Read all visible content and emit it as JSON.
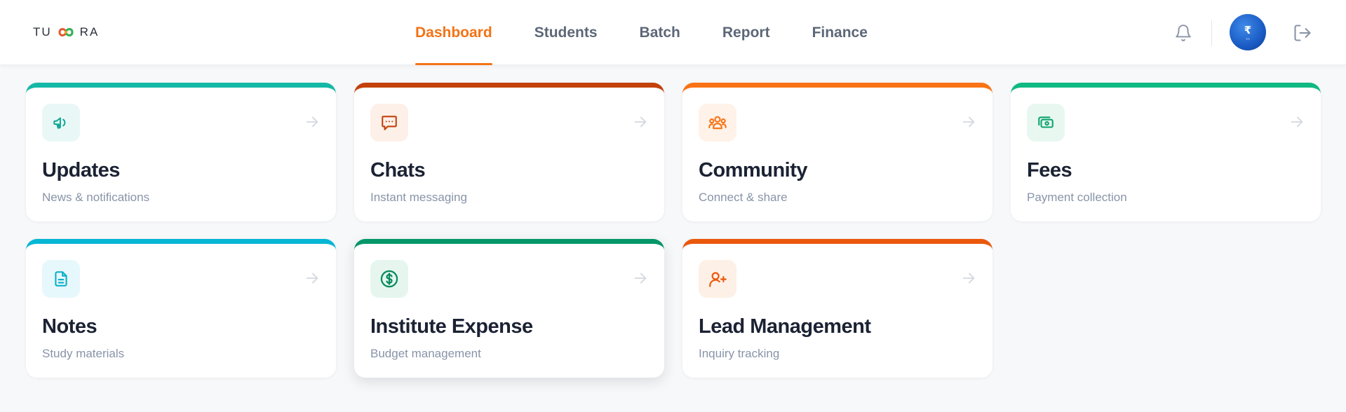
{
  "brand": {
    "logo_left": "TU",
    "logo_right": "RA"
  },
  "nav": {
    "tabs": [
      {
        "label": "Dashboard",
        "active": true
      },
      {
        "label": "Students",
        "active": false
      },
      {
        "label": "Batch",
        "active": false
      },
      {
        "label": "Report",
        "active": false
      },
      {
        "label": "Finance",
        "active": false
      }
    ],
    "accent": "#f47316"
  },
  "header_icons": [
    "bell-icon",
    "avatar",
    "logout-icon"
  ],
  "cards": [
    {
      "title": "Updates",
      "subtitle": "News & notifications",
      "icon": "megaphone-icon",
      "accent": "#14b8a6",
      "tint": "#e9f8f6",
      "iconColor": "#14a896"
    },
    {
      "title": "Chats",
      "subtitle": "Instant messaging",
      "icon": "chat-icon",
      "accent": "#c2410c",
      "tint": "#fdf0e8",
      "iconColor": "#c2410c"
    },
    {
      "title": "Community",
      "subtitle": "Connect & share",
      "icon": "users-icon",
      "accent": "#f97316",
      "tint": "#fff2e8",
      "iconColor": "#f97316"
    },
    {
      "title": "Fees",
      "subtitle": "Payment collection",
      "icon": "cash-icon",
      "accent": "#10b981",
      "tint": "#e8f8f1",
      "iconColor": "#0ea371"
    },
    {
      "title": "Notes",
      "subtitle": "Study materials",
      "icon": "document-icon",
      "accent": "#06b6d4",
      "tint": "#e6f8fb",
      "iconColor": "#0aaec9"
    },
    {
      "title": "Institute Expense",
      "subtitle": "Budget management",
      "icon": "dollar-icon",
      "accent": "#059669",
      "tint": "#e6f6ef",
      "iconColor": "#058a5f"
    },
    {
      "title": "Lead Management",
      "subtitle": "Inquiry tracking",
      "icon": "user-plus-icon",
      "accent": "#ea580c",
      "tint": "#fdf0e6",
      "iconColor": "#ea580c"
    }
  ]
}
